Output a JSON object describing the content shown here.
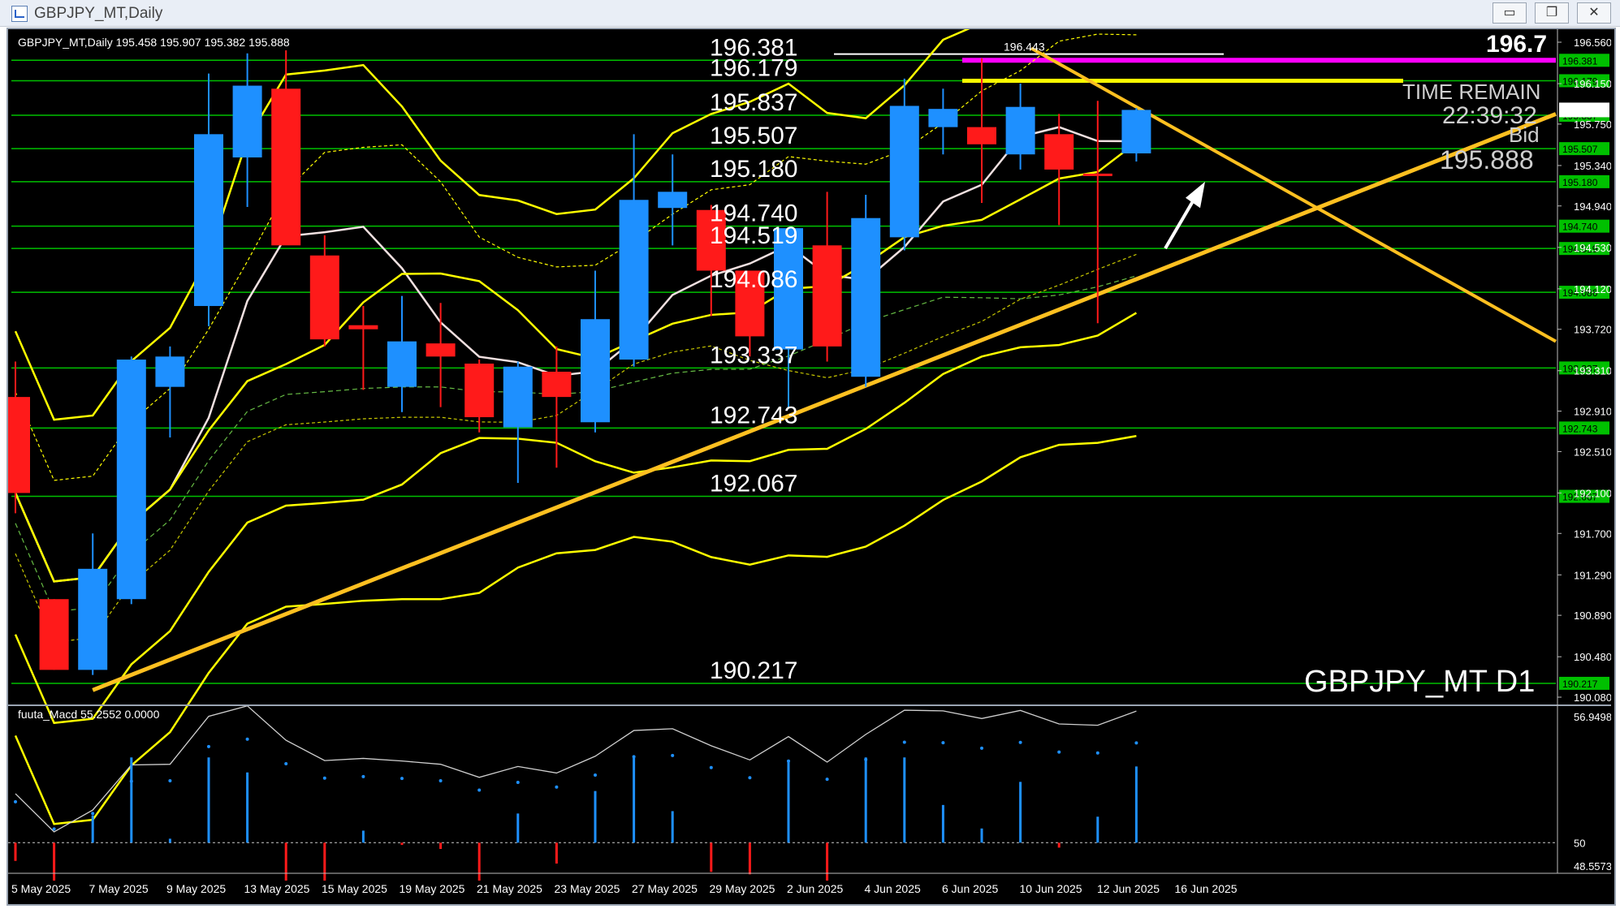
{
  "window": {
    "title": "GBPJPY_MT,Daily",
    "minimize_label": "▭",
    "restore_label": "❐",
    "close_label": "✕"
  },
  "chart_header": {
    "ohlc_text": "GBPJPY_MT,Daily  195.458 195.907 195.382 195.888",
    "corner_price": "196.7"
  },
  "chart_data": {
    "type": "candlestick",
    "symbol_label": "GBPJPY_MT D1",
    "price_axis": {
      "min": 190.08,
      "max": 196.56,
      "ticks": [
        "196.560",
        "196.150",
        "195.750",
        "195.340",
        "194.940",
        "194.530",
        "194.120",
        "193.720",
        "193.310",
        "192.910",
        "192.510",
        "192.100",
        "191.700",
        "191.290",
        "190.890",
        "190.480",
        "190.080"
      ]
    },
    "x_labels": [
      "5 May 2025",
      "7 May 2025",
      "9 May 2025",
      "13 May 2025",
      "15 May 2025",
      "19 May 2025",
      "21 May 2025",
      "23 May 2025",
      "27 May 2025",
      "29 May 2025",
      "2 Jun 2025",
      "4 Jun 2025",
      "6 Jun 2025",
      "10 Jun 2025",
      "12 Jun 2025",
      "16 Jun 2025"
    ],
    "candles": [
      {
        "o": 193.05,
        "h": 193.4,
        "l": 191.9,
        "c": 192.1
      },
      {
        "o": 191.05,
        "h": 191.05,
        "l": 190.35,
        "c": 190.35
      },
      {
        "o": 190.35,
        "h": 191.7,
        "l": 190.3,
        "c": 191.35
      },
      {
        "o": 191.05,
        "h": 193.45,
        "l": 191.0,
        "c": 193.42
      },
      {
        "o": 193.15,
        "h": 193.55,
        "l": 192.65,
        "c": 193.45
      },
      {
        "o": 193.95,
        "h": 196.25,
        "l": 193.75,
        "c": 195.65
      },
      {
        "o": 195.42,
        "h": 196.45,
        "l": 194.93,
        "c": 196.13
      },
      {
        "o": 196.1,
        "h": 196.48,
        "l": 194.7,
        "c": 194.55
      },
      {
        "o": 194.45,
        "h": 194.65,
        "l": 193.55,
        "c": 193.62
      },
      {
        "o": 193.76,
        "h": 193.95,
        "l": 193.12,
        "c": 193.72
      },
      {
        "o": 193.15,
        "h": 194.05,
        "l": 192.9,
        "c": 193.6
      },
      {
        "o": 193.58,
        "h": 193.98,
        "l": 192.95,
        "c": 193.45
      },
      {
        "o": 193.38,
        "h": 193.42,
        "l": 192.7,
        "c": 192.85
      },
      {
        "o": 192.75,
        "h": 193.4,
        "l": 192.2,
        "c": 193.35
      },
      {
        "o": 193.3,
        "h": 193.55,
        "l": 192.35,
        "c": 193.05
      },
      {
        "o": 192.8,
        "h": 194.3,
        "l": 192.7,
        "c": 193.82
      },
      {
        "o": 193.42,
        "h": 195.65,
        "l": 193.35,
        "c": 195.0
      },
      {
        "o": 194.92,
        "h": 195.45,
        "l": 194.55,
        "c": 195.08
      },
      {
        "o": 194.9,
        "h": 194.95,
        "l": 193.85,
        "c": 194.3
      },
      {
        "o": 194.3,
        "h": 194.25,
        "l": 193.45,
        "c": 193.65
      },
      {
        "o": 193.52,
        "h": 194.68,
        "l": 192.95,
        "c": 194.72
      },
      {
        "o": 194.55,
        "h": 195.08,
        "l": 193.4,
        "c": 193.55
      },
      {
        "o": 193.25,
        "h": 195.05,
        "l": 193.15,
        "c": 194.82
      },
      {
        "o": 194.63,
        "h": 196.2,
        "l": 194.5,
        "c": 195.93
      },
      {
        "o": 195.72,
        "h": 196.1,
        "l": 195.45,
        "c": 195.9
      },
      {
        "o": 195.72,
        "h": 196.4,
        "l": 194.97,
        "c": 195.55
      },
      {
        "o": 195.45,
        "h": 196.15,
        "l": 195.3,
        "c": 195.92
      },
      {
        "o": 195.65,
        "h": 195.85,
        "l": 194.75,
        "c": 195.3
      },
      {
        "o": 195.26,
        "h": 195.98,
        "l": 193.78,
        "c": 195.24
      },
      {
        "o": 195.46,
        "h": 195.91,
        "l": 195.38,
        "c": 195.89
      }
    ],
    "levels": [
      {
        "price": 196.381,
        "label": "196.381"
      },
      {
        "price": 196.179,
        "label": "196.179"
      },
      {
        "price": 195.837,
        "label": "195.837"
      },
      {
        "price": 195.507,
        "label": "195.507"
      },
      {
        "price": 195.18,
        "label": "195.180"
      },
      {
        "price": 194.74,
        "label": "194.740"
      },
      {
        "price": 194.519,
        "label": "194.519"
      },
      {
        "price": 194.086,
        "label": "194.086"
      },
      {
        "price": 193.337,
        "label": "193.337"
      },
      {
        "price": 192.743,
        "label": "192.743"
      },
      {
        "price": 192.067,
        "label": "192.067"
      },
      {
        "price": 190.217,
        "label": "190.217"
      }
    ],
    "high_marker": {
      "price": 196.443,
      "label": "196.443"
    },
    "info_panel": {
      "time_remain_label": "TIME REMAIN",
      "time_remain_value": "22:39:32",
      "bid_label": "Bid",
      "bid_value": "195.888"
    },
    "macd": {
      "label": "fuuta_Macd 55.2552  0.0000",
      "axis_ticks": [
        "56.9498",
        "50",
        "48.5573"
      ],
      "min": 48.5573,
      "max": 56.9498
    },
    "colors": {
      "bull": "#1e90ff",
      "bear": "#ff1a1a",
      "level": "#00c000",
      "band": "#ffff00",
      "trend": "#ffc020",
      "pink": "#ff00ff",
      "white_ma": "#f0e0e0"
    }
  }
}
